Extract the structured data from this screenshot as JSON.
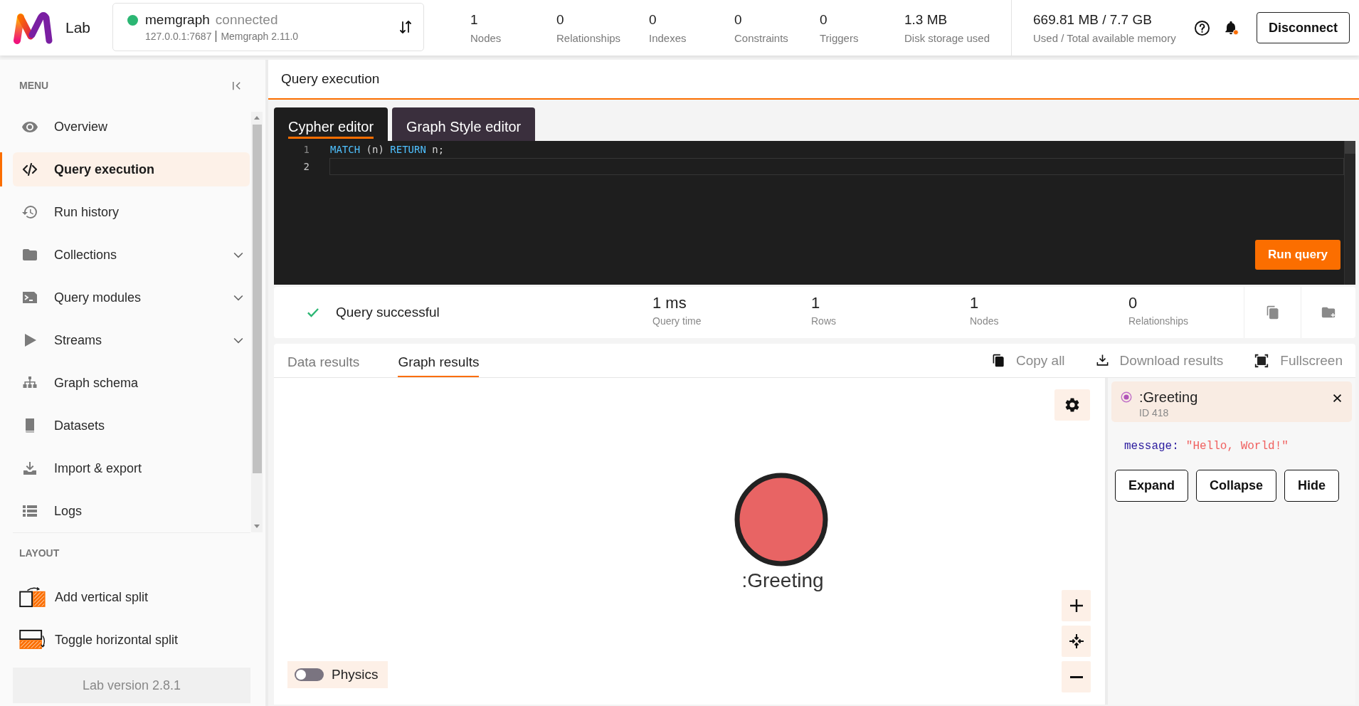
{
  "header": {
    "logo_text": "Lab",
    "connection": {
      "name": "memgraph",
      "status": "connected",
      "online": true,
      "address": "127.0.0.1:7687",
      "version": "Memgraph 2.11.0"
    },
    "stats": [
      {
        "value": "1",
        "label": "Nodes"
      },
      {
        "value": "0",
        "label": "Relationships"
      },
      {
        "value": "0",
        "label": "Indexes"
      },
      {
        "value": "0",
        "label": "Constraints"
      },
      {
        "value": "0",
        "label": "Triggers"
      },
      {
        "value": "1.3 MB",
        "label": "Disk storage used"
      }
    ],
    "memory": {
      "value": "669.81 MB / 7.7 GB",
      "label": "Used / Total available memory"
    },
    "notifications_unread": true,
    "disconnect_button": "Disconnect"
  },
  "sidebar": {
    "menu_title": "MENU",
    "items": [
      {
        "label": "Overview",
        "selected": false,
        "expandable": false
      },
      {
        "label": "Query execution",
        "selected": true,
        "expandable": false
      },
      {
        "label": "Run history",
        "selected": false,
        "expandable": false
      },
      {
        "label": "Collections",
        "selected": false,
        "expandable": true
      },
      {
        "label": "Query modules",
        "selected": false,
        "expandable": true
      },
      {
        "label": "Streams",
        "selected": false,
        "expandable": true
      },
      {
        "label": "Graph schema",
        "selected": false,
        "expandable": false
      },
      {
        "label": "Datasets",
        "selected": false,
        "expandable": false
      },
      {
        "label": "Import & export",
        "selected": false,
        "expandable": false
      },
      {
        "label": "Logs",
        "selected": false,
        "expandable": false
      }
    ],
    "layout_title": "LAYOUT",
    "layout_items": [
      {
        "label": "Add vertical split"
      },
      {
        "label": "Toggle horizontal split"
      }
    ],
    "version": "Lab version 2.8.1"
  },
  "page_title": "Query execution",
  "editor": {
    "tabs": [
      {
        "label": "Cypher editor",
        "selected": true
      },
      {
        "label": "Graph Style editor",
        "selected": false
      }
    ],
    "lines": [
      {
        "number": "1",
        "current": false,
        "tokens": [
          {
            "text": "MATCH",
            "kind": "keyword"
          },
          {
            "text": "(n)",
            "kind": "plain"
          },
          {
            "text": "RETURN",
            "kind": "keyword"
          },
          {
            "text": "n;",
            "kind": "plain"
          }
        ]
      },
      {
        "number": "2",
        "current": true
      }
    ],
    "run_button": "Run query"
  },
  "query_status": {
    "success": true,
    "message": "Query successful",
    "metrics": [
      {
        "value": "1 ms",
        "label": "Query time"
      },
      {
        "value": "1",
        "label": "Rows"
      },
      {
        "value": "1",
        "label": "Nodes"
      },
      {
        "value": "0",
        "label": "Relationships"
      }
    ]
  },
  "results": {
    "tabs": [
      {
        "label": "Data results",
        "selected": false
      },
      {
        "label": "Graph results",
        "selected": true
      }
    ],
    "actions": [
      {
        "label": "Copy all"
      },
      {
        "label": "Download results"
      },
      {
        "label": "Fullscreen"
      }
    ],
    "graph": {
      "nodes": [
        {
          "label": ":Greeting",
          "color": "#e86464"
        }
      ],
      "physics": {
        "label": "Physics",
        "on": false
      }
    },
    "details": {
      "title": ":Greeting",
      "id": "ID 418",
      "properties": [
        {
          "key": "message:",
          "value": "\"Hello, World!\""
        }
      ],
      "buttons": [
        "Expand",
        "Collapse",
        "Hide"
      ]
    }
  }
}
